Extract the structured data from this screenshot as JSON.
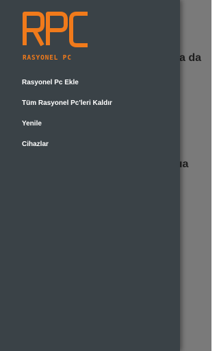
{
  "app": {
    "logo_text": "RPC",
    "logo_subtitle": "RASYONEL PC",
    "logo_color": "#f07a1b"
  },
  "drawer": {
    "background": "#3a4247",
    "items": [
      {
        "label": "Rasyonel Pc Ekle"
      },
      {
        "label": "Tüm Rasyonel Pc'leri Kaldır"
      },
      {
        "label": "Yenile"
      },
      {
        "label": "Cihazlar"
      }
    ]
  },
  "background_content": {
    "line1": "a da",
    "line2": "ıa"
  }
}
